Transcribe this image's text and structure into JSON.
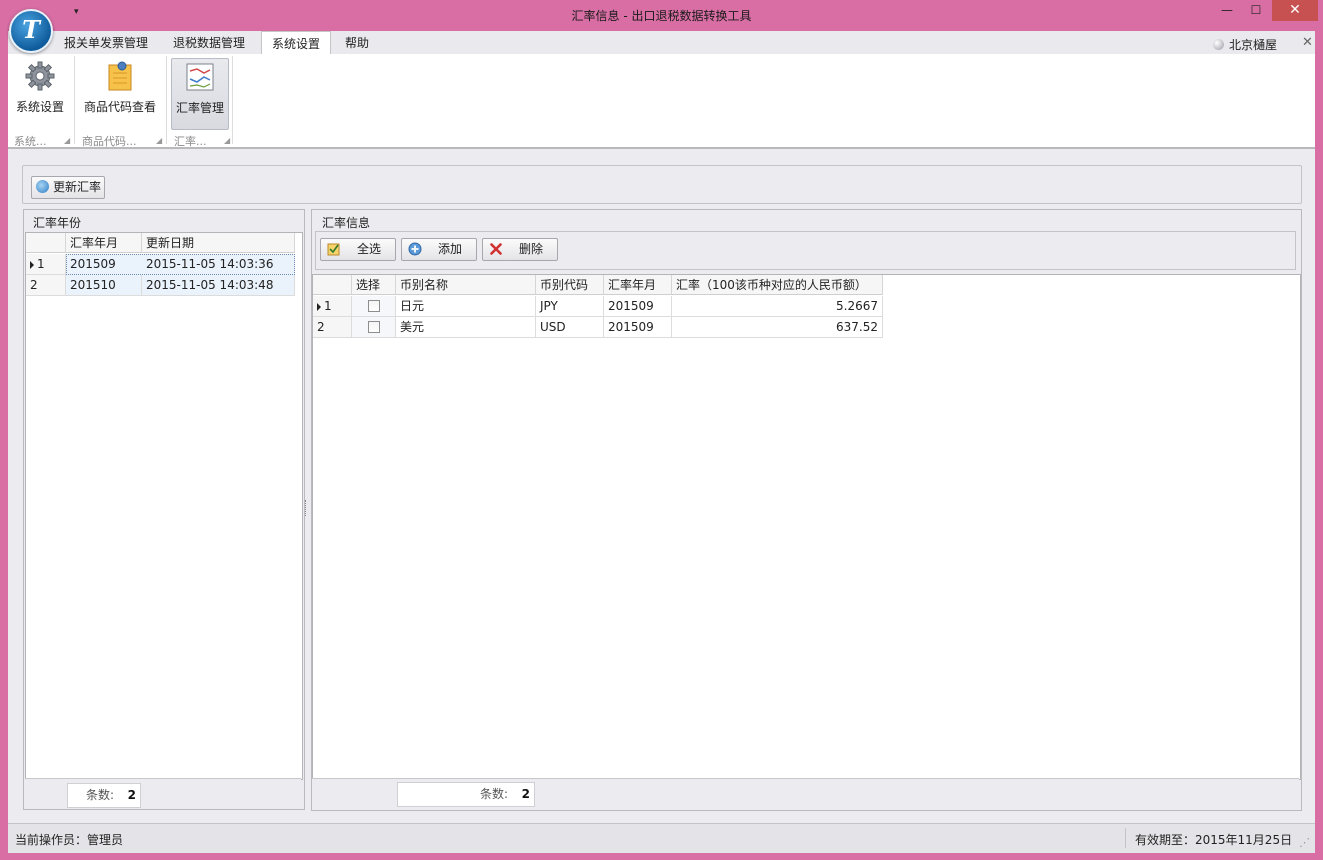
{
  "window": {
    "title": "汇率信息 - 出口退税数据转换工具",
    "logo_letter": "T",
    "qat_glyph": "▾",
    "min_glyph": "—",
    "max_glyph": "☐",
    "close_glyph": "✕"
  },
  "ribbon": {
    "tabs": [
      "报关单发票管理",
      "退税数据管理",
      "系统设置",
      "帮助"
    ],
    "active_tab": "系统设置",
    "user": "北京樋屋",
    "minimize_glyph": "✕",
    "buttons": [
      {
        "label": "系统设置",
        "icon": "gear-icon"
      },
      {
        "label": "商品代码查看",
        "icon": "notepad-icon"
      },
      {
        "label": "汇率管理",
        "icon": "chart-icon"
      }
    ],
    "group_labels": [
      "系统...",
      "商品代码...",
      "汇率..."
    ]
  },
  "toolbar": {
    "refresh_label": "更新汇率",
    "refresh_icon": "refresh-icon"
  },
  "left_panel": {
    "title": "汇率年份",
    "columns": [
      "汇率年月",
      "更新日期"
    ],
    "rows": [
      {
        "index": "1",
        "month": "201509",
        "updated": "2015-11-05 14:03:36"
      },
      {
        "index": "2",
        "month": "201510",
        "updated": "2015-11-05 14:03:48"
      }
    ],
    "count_label": "条数:",
    "count": "2"
  },
  "right_panel": {
    "title": "汇率信息",
    "select_all_label": "全选",
    "add_label": "添加",
    "delete_label": "删除",
    "columns": [
      "选择",
      "币别名称",
      "币别代码",
      "汇率年月",
      "汇率（100该币种对应的人民币额）"
    ],
    "rows": [
      {
        "index": "1",
        "name": "日元",
        "code": "JPY",
        "month": "201509",
        "rate": "5.2667"
      },
      {
        "index": "2",
        "name": "美元",
        "code": "USD",
        "month": "201509",
        "rate": "637.52"
      }
    ],
    "count_label": "条数:",
    "count": "2"
  },
  "status": {
    "operator": "当前操作员：管理员",
    "expiry": "有效期至：2015年11月25日",
    "grip_glyph": "⋰"
  },
  "colors": {
    "window_frame": "#d86ea4",
    "client_bg": "#ececf0",
    "selected_row": "#eaf2fb",
    "close_button": "#c75050"
  }
}
